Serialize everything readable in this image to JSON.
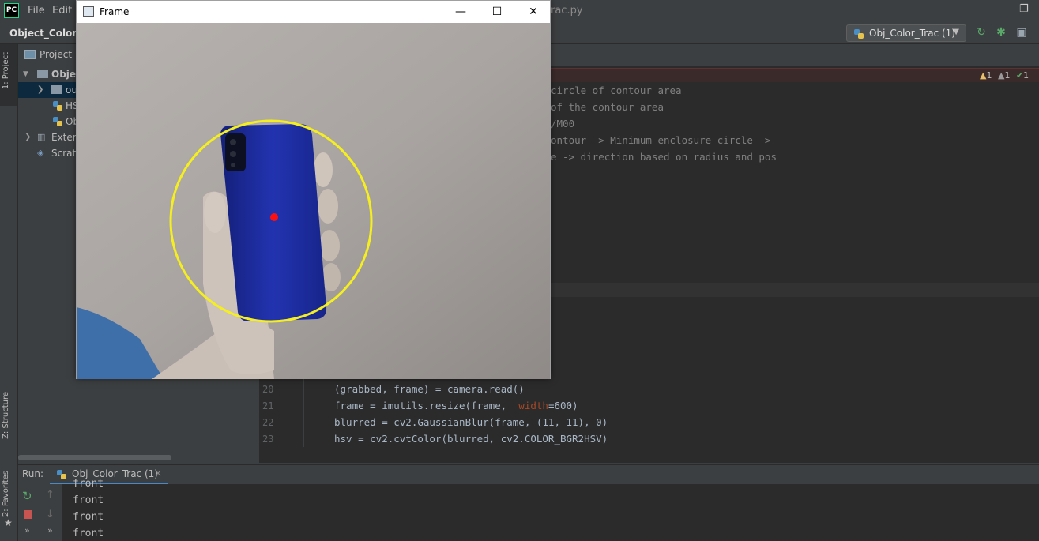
{
  "ide": {
    "logo": "PC",
    "menu": [
      "File",
      "Edit"
    ],
    "title_fragment": "rac.py",
    "project_name": "Object_Color_T",
    "run_config": "Obj_Color_Trac (1)",
    "inspections": {
      "warn1": "1",
      "warn2": "1",
      "ok": "1"
    }
  },
  "left_stripe": {
    "project_tab": "1: Project",
    "structure_tab": "Z: Structure",
    "favorites_tab": "2: Favorites"
  },
  "project_panel": {
    "header": "Project",
    "tree": [
      {
        "label": "Objec",
        "icon": "folder-icon",
        "bold": true
      },
      {
        "label": "ou",
        "icon": "folder-icon"
      },
      {
        "label": "HS",
        "icon": "python-file-icon"
      },
      {
        "label": "Ob",
        "icon": "python-file-icon"
      },
      {
        "label": "Exterr",
        "icon": "library-icon"
      },
      {
        "label": "Scratc",
        "icon": "scratch-icon"
      }
    ]
  },
  "editor": {
    "comment_lines": [
      "circle of contour area",
      "of the contour area",
      "/M00",
      "ontour -> Minimum enclosure circle ->",
      "e -> direction based on radius and pos"
    ],
    "code_lines": [
      {
        "num": "20",
        "text": "(grabbed, frame) = camera.read()"
      },
      {
        "num": "21",
        "pre": "frame = imutils.resize(frame,  ",
        "kw": "width",
        "post": "=600)"
      },
      {
        "num": "22",
        "text": "blurred = cv2.GaussianBlur(frame, (11, 11), 0)"
      },
      {
        "num": "23",
        "text": "hsv = cv2.cvtColor(blurred, cv2.COLOR_BGR2HSV)"
      }
    ]
  },
  "run": {
    "label": "Run:",
    "tab": "Obj_Color_Trac (1)",
    "output": [
      "front",
      "front",
      "front",
      "front"
    ]
  },
  "frame_window": {
    "title": "Frame",
    "minimize": "—",
    "maximize": "☐",
    "close": "✕"
  },
  "colors": {
    "tracking_circle": "#f5ef1d",
    "center_dot": "#ff1010",
    "phone": "#1a2a9a"
  }
}
